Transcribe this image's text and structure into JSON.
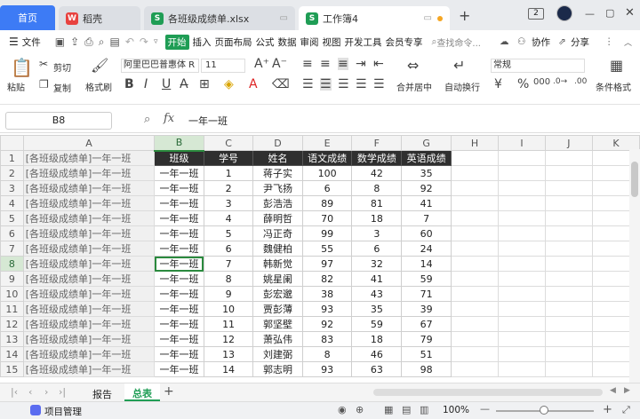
{
  "titlebar": {
    "home_tab": "首页",
    "tabs": [
      {
        "label": "稻壳",
        "icon": "docer-icon"
      },
      {
        "label": "各班级成绩单.xlsx",
        "icon": "sheet-icon"
      },
      {
        "label": "工作簿4",
        "icon": "sheet-icon"
      }
    ],
    "badge": "2"
  },
  "menu": {
    "file_label": "文件",
    "items": [
      "开始",
      "插入",
      "页面布局",
      "公式",
      "数据",
      "审阅",
      "视图",
      "开发工具",
      "会员专享"
    ],
    "search_placeholder": "查找命令...",
    "collab": "协作",
    "share": "分享"
  },
  "toolbar": {
    "paste": "粘贴",
    "cut": "剪切",
    "copy": "复制",
    "format_painter": "格式刷",
    "font_name": "阿里巴巴普惠体 R",
    "font_size": "11",
    "merge": "合并居中",
    "wrap": "自动换行",
    "number_format": "常规",
    "cond_format": "条件格式"
  },
  "formula": {
    "cell_ref": "B8",
    "value": "一年一班"
  },
  "grid": {
    "columns": [
      "A",
      "B",
      "C",
      "D",
      "E",
      "F",
      "G",
      "H",
      "I",
      "J",
      "K"
    ],
    "colA_text": "[各班级成绩单]一年一班",
    "headers": [
      "班级",
      "学号",
      "姓名",
      "语文成绩",
      "数学成绩",
      "英语成绩"
    ],
    "rows": [
      [
        "一年一班",
        "1",
        "蒋子实",
        "100",
        "42",
        "35"
      ],
      [
        "一年一班",
        "2",
        "尹飞扬",
        "6",
        "8",
        "92"
      ],
      [
        "一年一班",
        "3",
        "彭浩浩",
        "89",
        "81",
        "41"
      ],
      [
        "一年一班",
        "4",
        "薛明哲",
        "70",
        "18",
        "7"
      ],
      [
        "一年一班",
        "5",
        "冯正奇",
        "99",
        "3",
        "60"
      ],
      [
        "一年一班",
        "6",
        "魏健柏",
        "55",
        "6",
        "24"
      ],
      [
        "一年一班",
        "7",
        "韩新觉",
        "97",
        "32",
        "14"
      ],
      [
        "一年一班",
        "8",
        "姚星阑",
        "82",
        "41",
        "59"
      ],
      [
        "一年一班",
        "9",
        "彭宏邈",
        "38",
        "43",
        "71"
      ],
      [
        "一年一班",
        "10",
        "贾彭薄",
        "93",
        "35",
        "39"
      ],
      [
        "一年一班",
        "11",
        "郭坚壁",
        "92",
        "59",
        "67"
      ],
      [
        "一年一班",
        "12",
        "萧弘伟",
        "83",
        "18",
        "79"
      ],
      [
        "一年一班",
        "13",
        "刘建弼",
        "8",
        "46",
        "51"
      ],
      [
        "一年一班",
        "14",
        "郭志明",
        "93",
        "63",
        "98"
      ]
    ],
    "row_numbers": [
      "1",
      "2",
      "3",
      "4",
      "5",
      "6",
      "7",
      "8",
      "9",
      "10",
      "11",
      "12",
      "13",
      "14",
      "15"
    ]
  },
  "sheets": {
    "tabs": [
      "报告",
      "总表"
    ],
    "active": "总表"
  },
  "status": {
    "project": "项目管理",
    "zoom": "100%"
  },
  "colors": {
    "accent": "#3d7bf5",
    "header_bg": "#2f2f2f",
    "select_green": "#2b8a3e"
  }
}
